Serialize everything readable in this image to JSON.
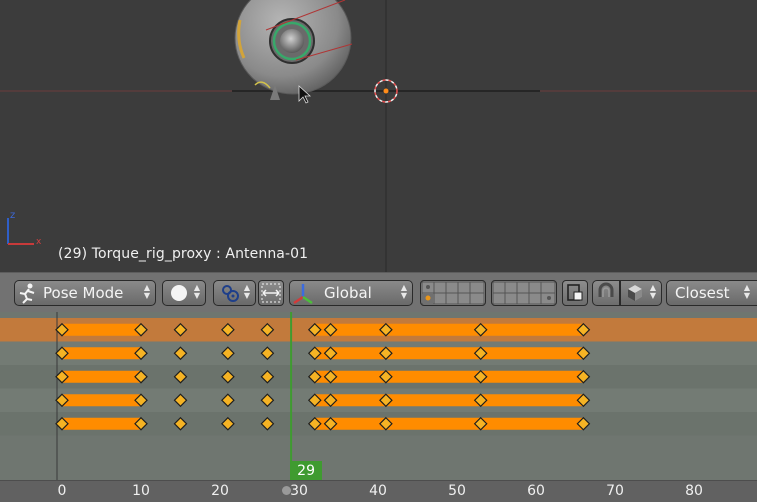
{
  "viewport": {
    "object_info": "(29) Torque_rig_proxy : Antenna-01"
  },
  "header": {
    "mode_label": "Pose Mode",
    "orientation_label": "Global",
    "snap_target_label": "Closest"
  },
  "timeline": {
    "current_frame": "29",
    "current_frame_value": 29,
    "ruler_labels": [
      "0",
      "10",
      "20",
      "30",
      "40",
      "50",
      "60",
      "70",
      "80"
    ],
    "ruler_values": [
      0,
      10,
      20,
      30,
      40,
      50,
      60,
      70,
      80
    ],
    "keyframes": [
      0,
      10,
      15,
      21,
      26,
      32,
      34,
      41,
      53,
      66
    ],
    "hold_segments": [
      [
        0,
        10
      ],
      [
        32,
        66
      ]
    ],
    "channel_count": 5,
    "selected_row": 0
  },
  "colors": {
    "keyframe": "#f5b324",
    "hold_bar": "#ff8c00",
    "current_frame": "#3f9b30",
    "selected_row": "#c27a3c"
  }
}
